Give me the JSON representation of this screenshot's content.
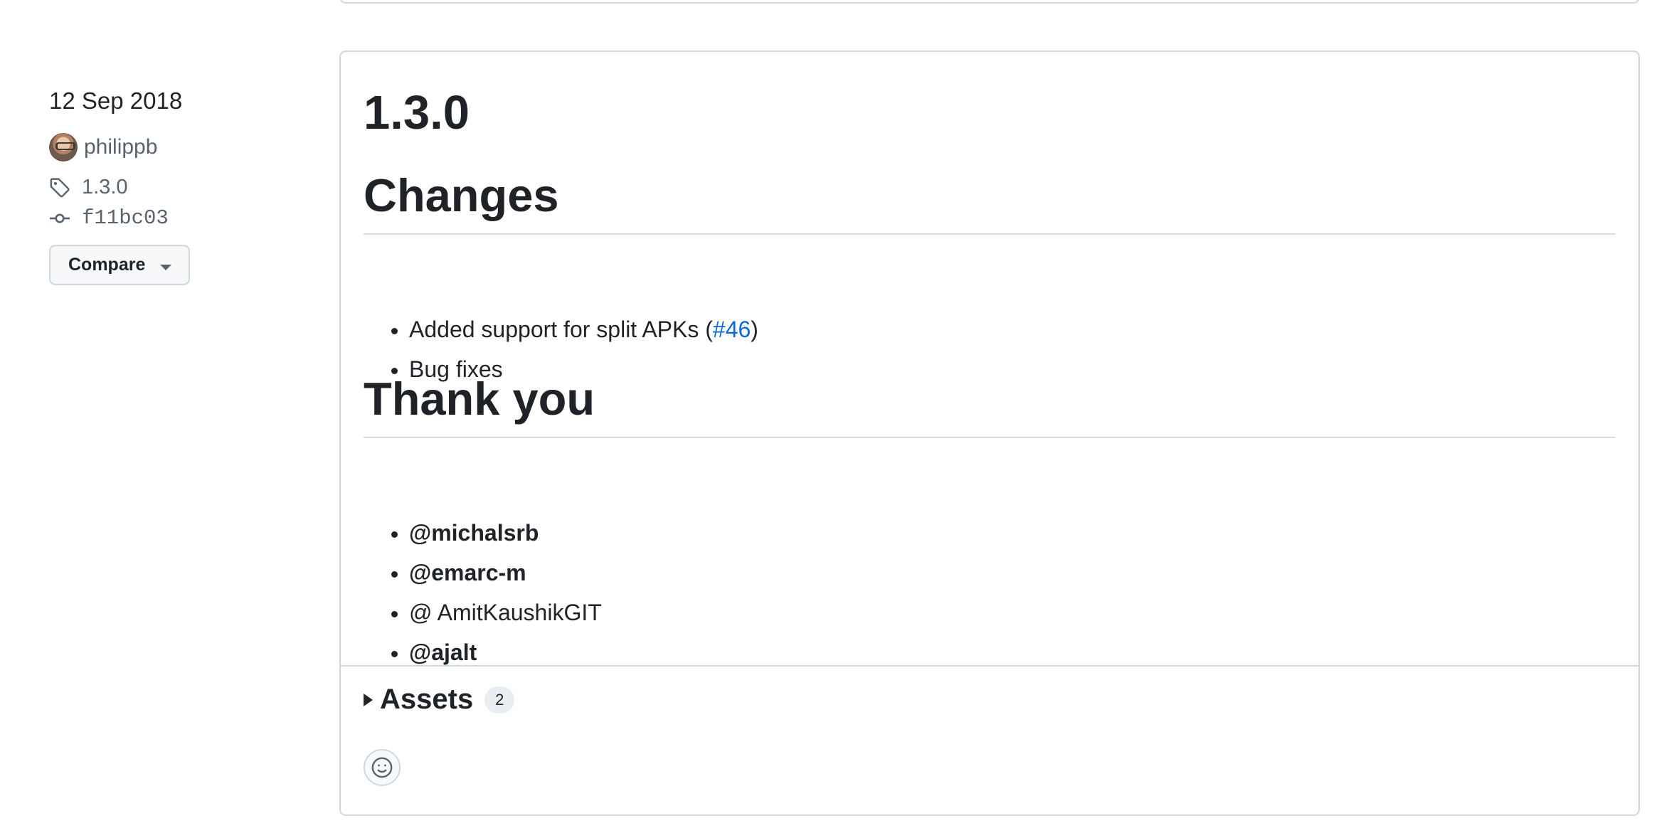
{
  "sidebar": {
    "date": "12 Sep 2018",
    "author": "philippb",
    "tag": "1.3.0",
    "commit": "f11bc03",
    "compare_label": "Compare"
  },
  "release": {
    "title": "1.3.0",
    "changes_heading": "Changes",
    "changes": {
      "item1_prefix": "Added support for split APKs (",
      "item1_link": "#46",
      "item1_suffix": ")",
      "item2": "Bug fixes"
    },
    "thanks_heading": "Thank you",
    "thanks": [
      "@michalsrb",
      "@emarc-m",
      "@ AmitKaushikGIT",
      "@ajalt"
    ]
  },
  "assets": {
    "label": "Assets",
    "count": "2"
  },
  "icons": {
    "tag": "tag-icon",
    "commit": "git-commit-icon",
    "caret": "triangle-down-icon",
    "assets_toggle": "triangle-right-icon",
    "reaction": "smiley-icon"
  },
  "colors": {
    "link": "#0969da",
    "border": "#d0d7de",
    "muted_text": "#59636e",
    "text": "#1f2328"
  }
}
